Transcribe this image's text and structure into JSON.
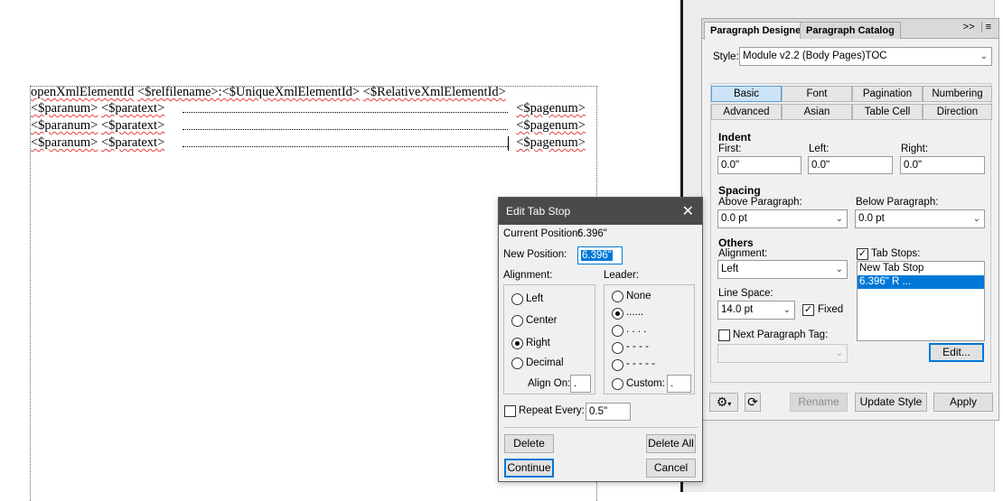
{
  "document": {
    "line1": {
      "part1": "openXmlElementId",
      "part2": "<$relfilename>:<$UniqueXmlElementId>",
      "part3": "<$RelativeXmlElementId>"
    },
    "toc_lines": [
      {
        "paranum": "<$paranum>",
        "paratext": "<$paratext>",
        "pagenum": "<$pagenum>"
      },
      {
        "paranum": "<$paranum>",
        "paratext": "<$paratext>",
        "pagenum": "<$pagenum>"
      },
      {
        "paranum": "<$paranum>",
        "paratext": "<$paratext>",
        "pagenum": "<$pagenum>"
      }
    ]
  },
  "panel": {
    "tabs": [
      "Paragraph Designer",
      "Paragraph Catalog"
    ],
    "menu_icons": [
      ">>",
      "≡"
    ],
    "style_label": "Style:",
    "style_value": "Module v2.2 (Body Pages)TOC",
    "property_tabs_row1": [
      "Basic",
      "Font",
      "Pagination",
      "Numbering"
    ],
    "property_tabs_row2": [
      "Advanced",
      "Asian",
      "Table Cell",
      "Direction"
    ],
    "indent": {
      "title": "Indent",
      "first_label": "First:",
      "first_value": "0.0\"",
      "left_label": "Left:",
      "left_value": "0.0\"",
      "right_label": "Right:",
      "right_value": "0.0\""
    },
    "spacing": {
      "title": "Spacing",
      "above_label": "Above Paragraph:",
      "above_value": "0.0 pt",
      "below_label": "Below Paragraph:",
      "below_value": "0.0 pt"
    },
    "others": {
      "title": "Others",
      "alignment_label": "Alignment:",
      "alignment_value": "Left",
      "line_space_label": "Line Space:",
      "line_space_value": "14.0 pt",
      "fixed_label": "Fixed",
      "next_tag_label": "Next Paragraph Tag:",
      "tab_stops_label": "Tab Stops:",
      "tab_stops_items": [
        "New Tab Stop",
        "6.396\"  R  ..."
      ],
      "edit_button": "Edit..."
    },
    "buttons": {
      "rename": "Rename",
      "update_style": "Update Style",
      "apply": "Apply"
    }
  },
  "dialog": {
    "title": "Edit Tab Stop",
    "current_position_label": "Current Position:",
    "current_position_value": "6.396\"",
    "new_position_label": "New Position:",
    "new_position_value": "6.396\"",
    "alignment_label": "Alignment:",
    "alignment_options": [
      "Left",
      "Center",
      "Right",
      "Decimal"
    ],
    "alignment_selected": "Right",
    "align_on_label": "Align On:",
    "align_on_value": ".",
    "leader_label": "Leader:",
    "leader_options": [
      "None",
      "......",
      ". . . .",
      "- - - -",
      "- - - - -"
    ],
    "leader_custom_label": "Custom:",
    "leader_custom_value": ".",
    "repeat_label": "Repeat Every:",
    "repeat_value": "0.5\"",
    "buttons": {
      "delete": "Delete",
      "delete_all": "Delete All",
      "continue": "Continue",
      "cancel": "Cancel"
    }
  },
  "colors": {
    "accent": "#0078d7",
    "dialog_title_bg": "#4a4a4a"
  }
}
